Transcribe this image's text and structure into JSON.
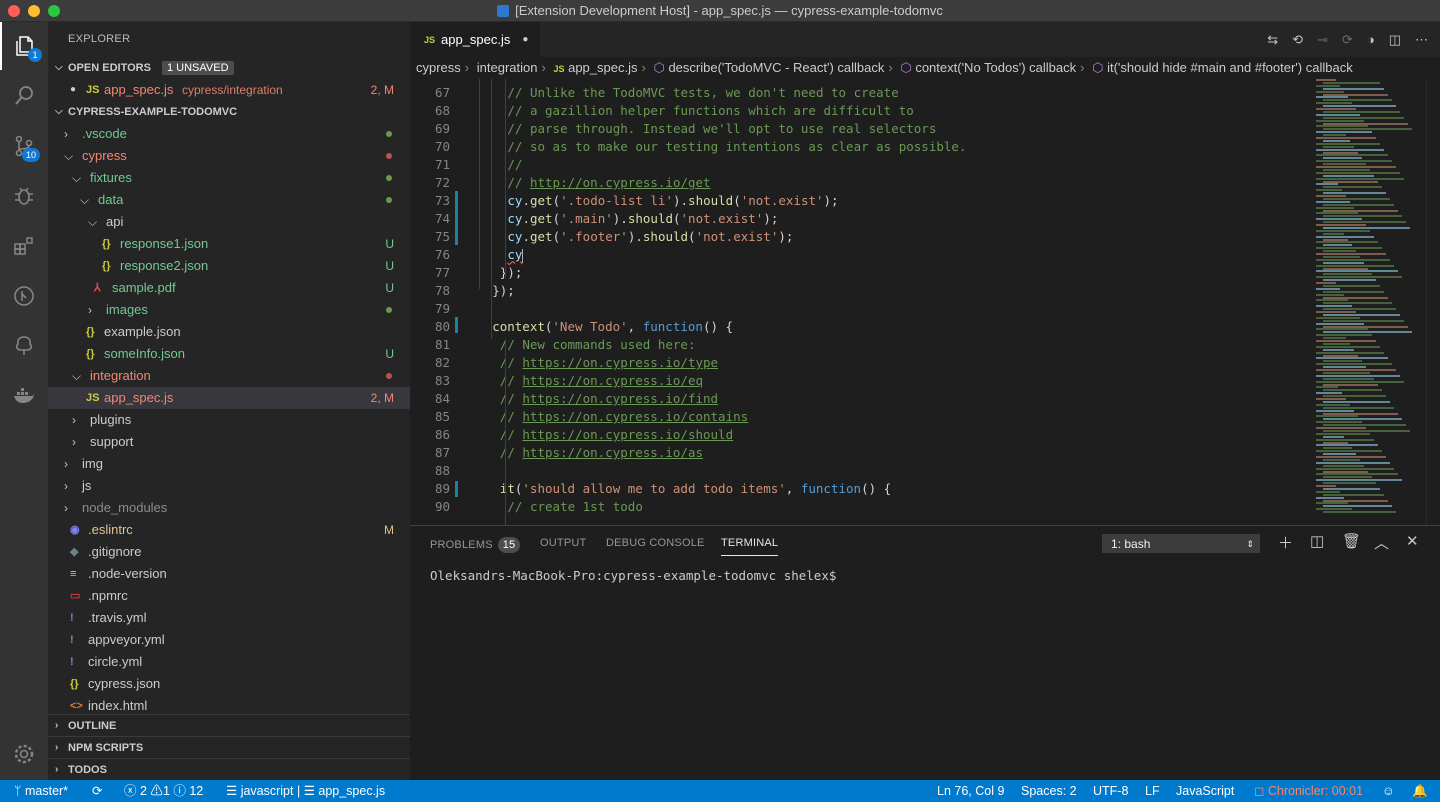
{
  "window": {
    "title": "[Extension Development Host] - app_spec.js — cypress-example-todomvc"
  },
  "activity": {
    "explorer_badge": "1",
    "scm_badge": "10"
  },
  "sidebar": {
    "title": "EXPLORER",
    "open_editors": {
      "label": "OPEN EDITORS",
      "unsaved_badge": "1 UNSAVED",
      "file": {
        "name": "app_spec.js",
        "path": "cypress/integration",
        "status": "2, M"
      }
    },
    "project": "CYPRESS-EXAMPLE-TODOMVC",
    "tree": [
      {
        "name": ".vscode",
        "kind": "folder",
        "status": "",
        "dot": "#6a9955"
      },
      {
        "name": "cypress",
        "kind": "folder-open",
        "status": "",
        "dot": "#b85450"
      },
      {
        "name": "fixtures",
        "kind": "folder-open",
        "status": "",
        "dot": "#6a9955"
      },
      {
        "name": "data",
        "kind": "folder-open",
        "status": "",
        "dot": "#6a9955"
      },
      {
        "name": "api",
        "kind": "folder-open",
        "status": "",
        "dot": ""
      },
      {
        "name": "response1.json",
        "kind": "json",
        "status": "U",
        "dot": ""
      },
      {
        "name": "response2.json",
        "kind": "json",
        "status": "U",
        "dot": ""
      },
      {
        "name": "sample.pdf",
        "kind": "pdf",
        "status": "U",
        "dot": ""
      },
      {
        "name": "images",
        "kind": "folder",
        "status": "",
        "dot": "#6a9955"
      },
      {
        "name": "example.json",
        "kind": "json",
        "status": "",
        "dot": ""
      },
      {
        "name": "someInfo.json",
        "kind": "json",
        "status": "U",
        "dot": ""
      },
      {
        "name": "integration",
        "kind": "folder-open",
        "status": "",
        "dot": "#b85450"
      },
      {
        "name": "app_spec.js",
        "kind": "js",
        "status": "2, M",
        "dot": ""
      },
      {
        "name": "plugins",
        "kind": "folder",
        "status": "",
        "dot": ""
      },
      {
        "name": "support",
        "kind": "folder",
        "status": "",
        "dot": ""
      },
      {
        "name": "img",
        "kind": "folder",
        "status": "",
        "dot": ""
      },
      {
        "name": "js",
        "kind": "folder",
        "status": "",
        "dot": ""
      },
      {
        "name": "node_modules",
        "kind": "folder",
        "status": "",
        "dot": ""
      },
      {
        "name": ".eslintrc",
        "kind": "eslint",
        "status": "M",
        "dot": ""
      },
      {
        "name": ".gitignore",
        "kind": "gitignore",
        "status": "",
        "dot": ""
      },
      {
        "name": ".node-version",
        "kind": "text",
        "status": "",
        "dot": ""
      },
      {
        "name": ".npmrc",
        "kind": "npm",
        "status": "",
        "dot": ""
      },
      {
        "name": ".travis.yml",
        "kind": "yml",
        "status": "",
        "dot": ""
      },
      {
        "name": "appveyor.yml",
        "kind": "yml",
        "status": "",
        "dot": ""
      },
      {
        "name": "circle.yml",
        "kind": "yml",
        "status": "",
        "dot": ""
      },
      {
        "name": "cypress.json",
        "kind": "json",
        "status": "",
        "dot": ""
      },
      {
        "name": "index.html",
        "kind": "html",
        "status": "",
        "dot": ""
      }
    ],
    "outline": "OUTLINE",
    "npm_scripts": "NPM SCRIPTS",
    "todos": "TODOS"
  },
  "tab": {
    "name": "app_spec.js"
  },
  "breadcrumb": [
    "cypress",
    "integration",
    "app_spec.js",
    "describe('TodoMVC - React') callback",
    "context('No Todos') callback",
    "it('should hide #main and #footer') callback"
  ],
  "editor": {
    "lines": [
      {
        "n": "67",
        "t": "// Unlike the TodoMVC tests, we don't need to create"
      },
      {
        "n": "68",
        "t": "// a gazillion helper functions which are difficult to"
      },
      {
        "n": "69",
        "t": "// parse through. Instead we'll opt to use real selectors"
      },
      {
        "n": "70",
        "t": "// so as to make our testing intentions as clear as possible."
      },
      {
        "n": "71",
        "t": "//"
      },
      {
        "n": "72",
        "t": "// http://on.cypress.io/get"
      },
      {
        "n": "73",
        "t": "cy.get('.todo-list li').should('not.exist');"
      },
      {
        "n": "74",
        "t": "cy.get('.main').should('not.exist');"
      },
      {
        "n": "75",
        "t": "cy.get('.footer').should('not.exist');"
      },
      {
        "n": "76",
        "t": "cy"
      },
      {
        "n": "77",
        "t": "});"
      },
      {
        "n": "78",
        "t": "});"
      },
      {
        "n": "79",
        "t": ""
      },
      {
        "n": "80",
        "t": "context('New Todo', function() {"
      },
      {
        "n": "81",
        "t": "// New commands used here:"
      },
      {
        "n": "82",
        "t": "// https://on.cypress.io/type"
      },
      {
        "n": "83",
        "t": "// https://on.cypress.io/eq"
      },
      {
        "n": "84",
        "t": "// https://on.cypress.io/find"
      },
      {
        "n": "85",
        "t": "// https://on.cypress.io/contains"
      },
      {
        "n": "86",
        "t": "// https://on.cypress.io/should"
      },
      {
        "n": "87",
        "t": "// https://on.cypress.io/as"
      },
      {
        "n": "88",
        "t": ""
      },
      {
        "n": "89",
        "t": "it('should allow me to add todo items', function() {"
      },
      {
        "n": "90",
        "t": "// create 1st todo"
      }
    ]
  },
  "panel": {
    "tabs": [
      "PROBLEMS",
      "OUTPUT",
      "DEBUG CONSOLE",
      "TERMINAL"
    ],
    "problems_count": "15",
    "terminal_select": "1: bash",
    "terminal_prompt": "Oleksandrs-MacBook-Pro:cypress-example-todomvc shelex$"
  },
  "status": {
    "branch": "master*",
    "errors": "2",
    "warnings": "1",
    "infos": "12",
    "lang_crumb": "javascript",
    "file_crumb": "app_spec.js",
    "position": "Ln 76, Col 9",
    "spaces": "Spaces: 2",
    "encoding": "UTF-8",
    "eol": "LF",
    "language": "JavaScript",
    "chronicler": "Chronicler: 00:01"
  },
  "colors": {
    "accent": "#007acc",
    "background": "#1e1e1e",
    "sidebar": "#252526"
  }
}
